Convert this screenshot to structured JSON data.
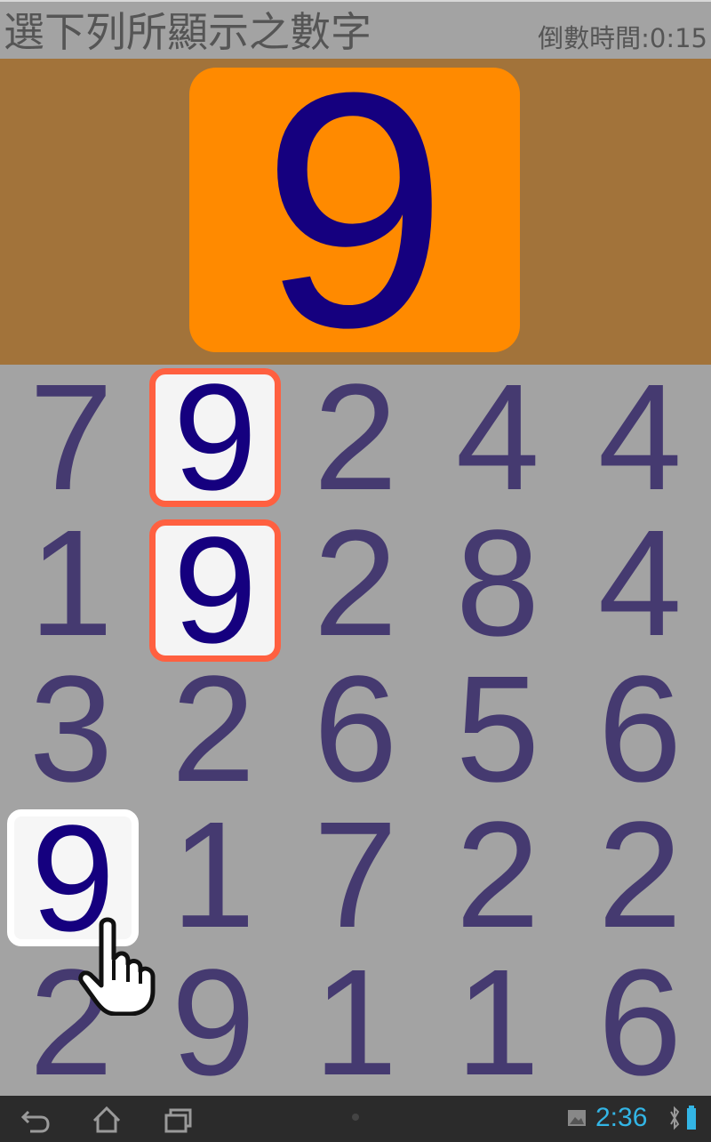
{
  "header": {
    "title": "選下列所顯示之數字",
    "timer": "倒數時間:0:15"
  },
  "target": {
    "digit": "9"
  },
  "grid": {
    "rows": [
      [
        "7",
        "9",
        "2",
        "4",
        "4"
      ],
      [
        "1",
        "9",
        "2",
        "8",
        "4"
      ],
      [
        "3",
        "2",
        "6",
        "5",
        "6"
      ],
      [
        "9",
        "1",
        "7",
        "2",
        "2"
      ],
      [
        "2",
        "9",
        "1",
        "1",
        "6"
      ]
    ],
    "highlighted_red": [
      [
        0,
        1
      ],
      [
        1,
        1
      ]
    ],
    "highlighted_white": [
      [
        3,
        0
      ]
    ]
  },
  "colors": {
    "target_bg": "#ff8a00",
    "panel_bg": "#a2733a",
    "digit_dark": "#15007f",
    "digit": "#453a70",
    "highlight_border": "#ff6040"
  },
  "navbar": {
    "icons": [
      "back-icon",
      "home-icon",
      "recent-apps-icon",
      "gallery-icon",
      "bluetooth-icon",
      "battery-icon"
    ],
    "time": "2:36"
  }
}
